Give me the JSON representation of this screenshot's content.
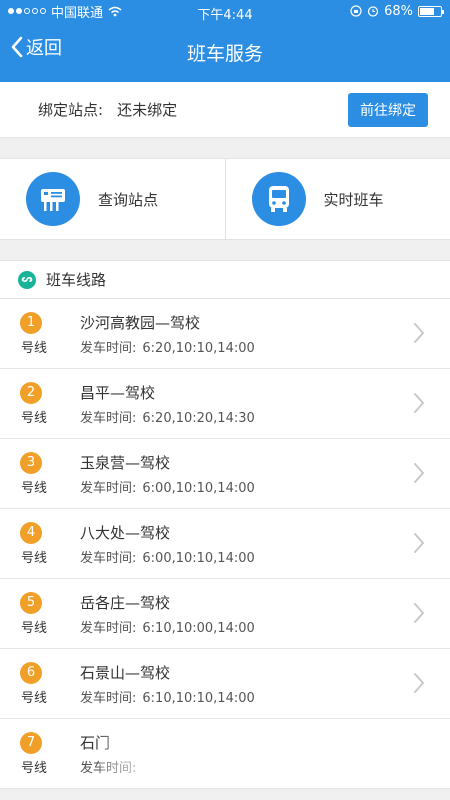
{
  "status": {
    "carrier": "中国联通",
    "time": "下午4:44",
    "battery": "68%",
    "battery_fraction": 0.68
  },
  "nav": {
    "back_label": "返回",
    "title": "班车服务"
  },
  "bind": {
    "label": "绑定站点:",
    "value": "还未绑定",
    "button": "前往绑定"
  },
  "cards": [
    {
      "label": "查询站点",
      "icon": "station-icon"
    },
    {
      "label": "实时班车",
      "icon": "bus-icon"
    }
  ],
  "routes": {
    "title": "班车线路",
    "suffix": "号线",
    "time_label": "发车时间:",
    "items": [
      {
        "num": "1",
        "name": "沙河高教园—驾校",
        "times": "6:20,10:10,14:00"
      },
      {
        "num": "2",
        "name": "昌平—驾校",
        "times": "6:20,10:20,14:30"
      },
      {
        "num": "3",
        "name": "玉泉营—驾校",
        "times": "6:00,10:10,14:00"
      },
      {
        "num": "4",
        "name": "八大处—驾校",
        "times": "6:00,10:10,14:00"
      },
      {
        "num": "5",
        "name": "岳各庄—驾校",
        "times": "6:10,10:00,14:00"
      },
      {
        "num": "6",
        "name": "石景山—驾校",
        "times": "6:10,10:10,14:00"
      },
      {
        "num": "7",
        "name": "石门",
        "times": ""
      }
    ]
  }
}
